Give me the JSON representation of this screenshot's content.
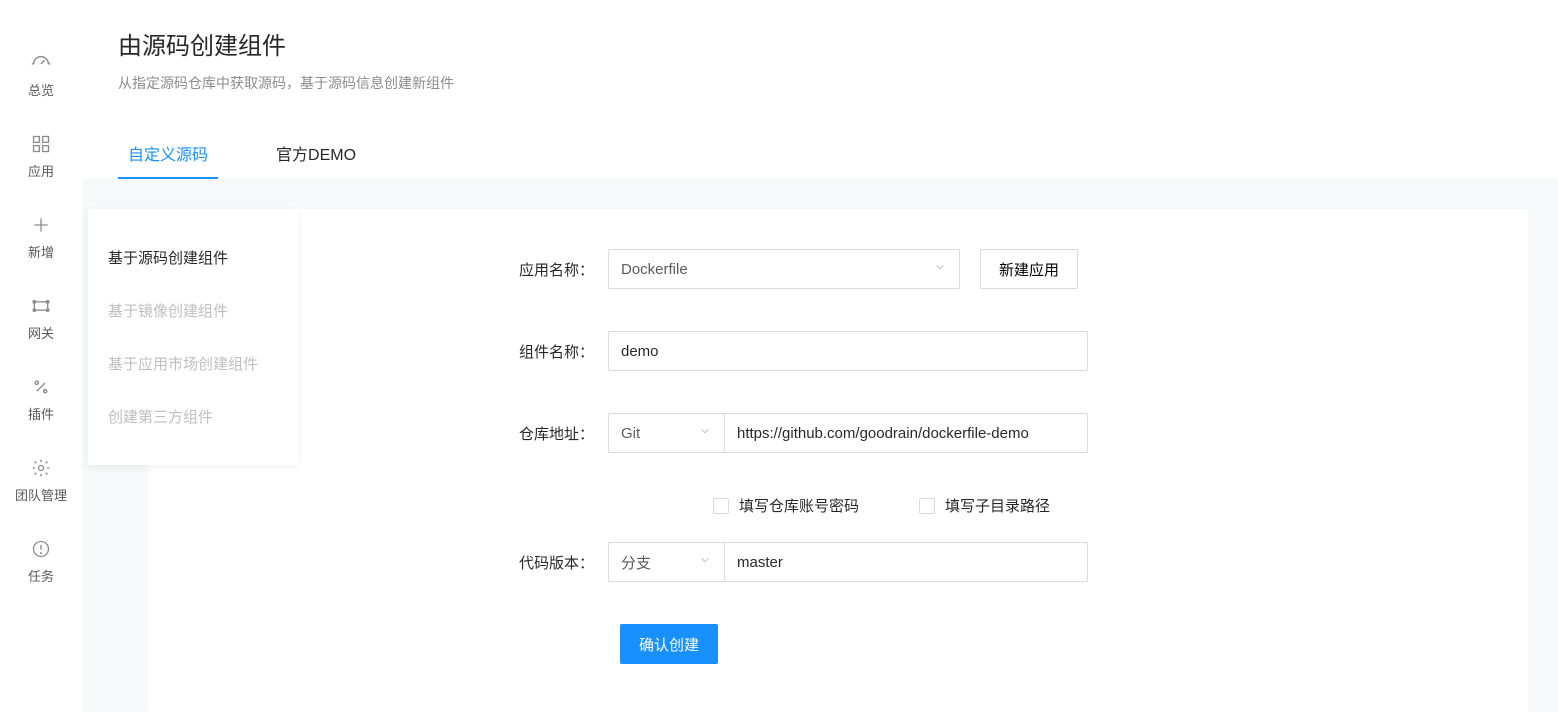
{
  "sidebar": {
    "items": [
      {
        "label": "总览",
        "icon": "dashboard-icon"
      },
      {
        "label": "应用",
        "icon": "apps-icon"
      },
      {
        "label": "新增",
        "icon": "plus-icon"
      },
      {
        "label": "网关",
        "icon": "gateway-icon"
      },
      {
        "label": "插件",
        "icon": "plugin-icon"
      },
      {
        "label": "团队管理",
        "icon": "gear-icon"
      },
      {
        "label": "任务",
        "icon": "alert-icon"
      }
    ]
  },
  "header": {
    "title": "由源码创建组件",
    "subtitle": "从指定源码仓库中获取源码，基于源码信息创建新组件"
  },
  "tabs": [
    {
      "label": "自定义源码",
      "active": true
    },
    {
      "label": "官方DEMO",
      "active": false
    }
  ],
  "side_nav": [
    {
      "label": "基于源码创建组件",
      "active": true
    },
    {
      "label": "基于镜像创建组件",
      "active": false
    },
    {
      "label": "基于应用市场创建组件",
      "active": false
    },
    {
      "label": "创建第三方组件",
      "active": false
    }
  ],
  "form": {
    "app_name": {
      "label": "应用名称：",
      "value": "Dockerfile",
      "new_btn": "新建应用"
    },
    "component_name": {
      "label": "组件名称：",
      "value": "demo"
    },
    "repo": {
      "label": "仓库地址：",
      "type_value": "Git",
      "url_value": "https://github.com/goodrain/dockerfile-demo"
    },
    "checkboxes": {
      "account": "填写仓库账号密码",
      "subdir": "填写子目录路径"
    },
    "code_version": {
      "label": "代码版本：",
      "type_value": "分支",
      "branch_value": "master"
    },
    "submit": "确认创建"
  }
}
